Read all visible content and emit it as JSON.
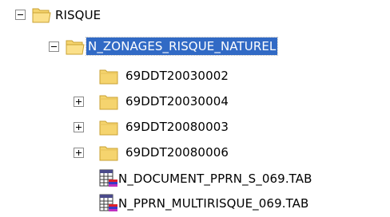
{
  "tree": {
    "root": {
      "label": "RISQUE",
      "state": "expanded"
    },
    "zonages": {
      "label": "N_ZONAGES_RISQUE_NATUREL",
      "state": "expanded",
      "selected": true
    },
    "folders": [
      {
        "label": "69DDT20030002",
        "state": "leaf"
      },
      {
        "label": "69DDT20030004",
        "state": "collapsed"
      },
      {
        "label": "69DDT20080003",
        "state": "collapsed"
      },
      {
        "label": "69DDT20080006",
        "state": "collapsed"
      }
    ],
    "files": [
      {
        "label": "N_DOCUMENT_PPRN_S_069.TAB",
        "icon": "table-file-icon"
      },
      {
        "label": "N_PPRN_MULTIRISQUE_069.TAB",
        "icon": "table-file-icon"
      }
    ]
  },
  "colors": {
    "selection": "#316ac5",
    "folder_fill": "#f5d46e",
    "folder_edge": "#c9a233"
  }
}
